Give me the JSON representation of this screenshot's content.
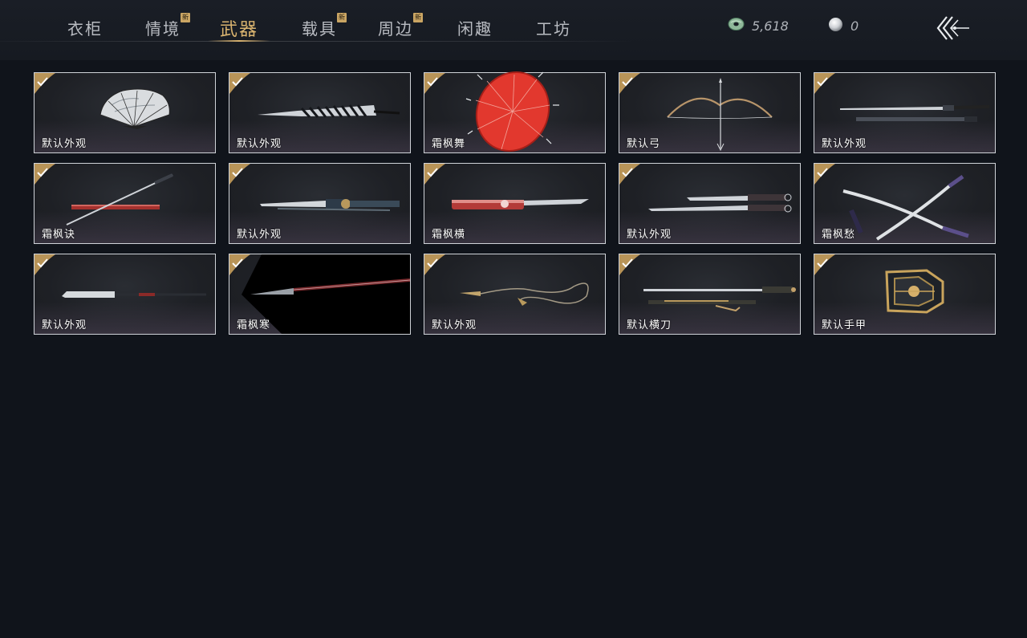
{
  "tabs": [
    {
      "label": "衣柜",
      "new": false,
      "active": false
    },
    {
      "label": "情境",
      "new": true,
      "active": false
    },
    {
      "label": "武器",
      "new": false,
      "active": true
    },
    {
      "label": "载具",
      "new": true,
      "active": false
    },
    {
      "label": "周边",
      "new": true,
      "active": false
    },
    {
      "label": "闲趣",
      "new": false,
      "active": false
    },
    {
      "label": "工坊",
      "new": false,
      "active": false
    }
  ],
  "new_badge": "新",
  "currency": {
    "jade": "5,618",
    "pearl": "0"
  },
  "icons": {
    "jade": "jade-coin-icon",
    "pearl": "pearl-icon",
    "back": "back-arrow-icon",
    "check": "owned-check-icon"
  },
  "colors": {
    "accent": "#d9b36f",
    "background": "#10141b",
    "card_border": "#cfd3d8"
  },
  "items": [
    {
      "label": "默认外观",
      "icon": "folding-fan-icon"
    },
    {
      "label": "默认外观",
      "icon": "closed-fan-icon"
    },
    {
      "label": "霜枫舞",
      "icon": "red-umbrella-icon"
    },
    {
      "label": "默认弓",
      "icon": "bow-icon"
    },
    {
      "label": "默认外观",
      "icon": "twin-sword-icon"
    },
    {
      "label": "霜枫诀",
      "icon": "sword-and-scabbard-icon"
    },
    {
      "label": "默认外观",
      "icon": "ornate-blade-icon"
    },
    {
      "label": "霜枫横",
      "icon": "red-blade-icon"
    },
    {
      "label": "默认外观",
      "icon": "twin-sabers-icon"
    },
    {
      "label": "霜枫愁",
      "icon": "crossed-sabers-icon"
    },
    {
      "label": "默认外观",
      "icon": "glaive-icon"
    },
    {
      "label": "霜枫寒",
      "icon": "dark-spear-icon"
    },
    {
      "label": "默认外观",
      "icon": "rope-dart-icon"
    },
    {
      "label": "默认横刀",
      "icon": "hengdao-icon"
    },
    {
      "label": "默认手甲",
      "icon": "gauntlet-icon"
    }
  ]
}
